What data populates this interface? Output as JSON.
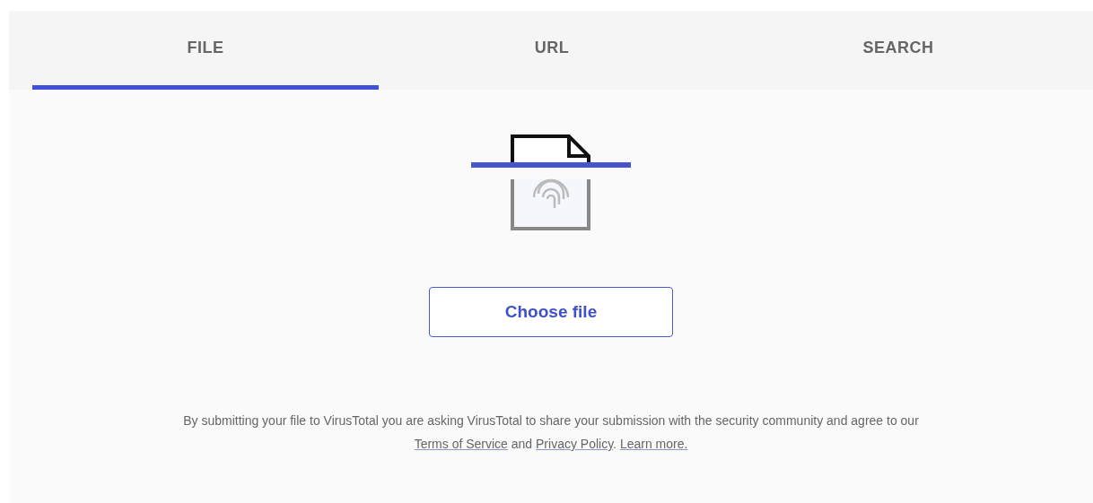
{
  "tabs": [
    {
      "label": "FILE",
      "selected": true
    },
    {
      "label": "URL",
      "selected": false
    },
    {
      "label": "SEARCH",
      "selected": false
    }
  ],
  "upload_button": {
    "label": "Choose file"
  },
  "notice": {
    "parts": [
      {
        "kind": "text",
        "text": "By submitting your file to VirusTotal you are asking VirusTotal to share your submission with the security community and agree to our "
      },
      {
        "kind": "link",
        "text": "Terms of Service"
      },
      {
        "kind": "text",
        "text": " and "
      },
      {
        "kind": "link",
        "text": "Privacy Policy"
      },
      {
        "kind": "text",
        "text": ". "
      },
      {
        "kind": "link",
        "text": "Learn more."
      }
    ]
  }
}
